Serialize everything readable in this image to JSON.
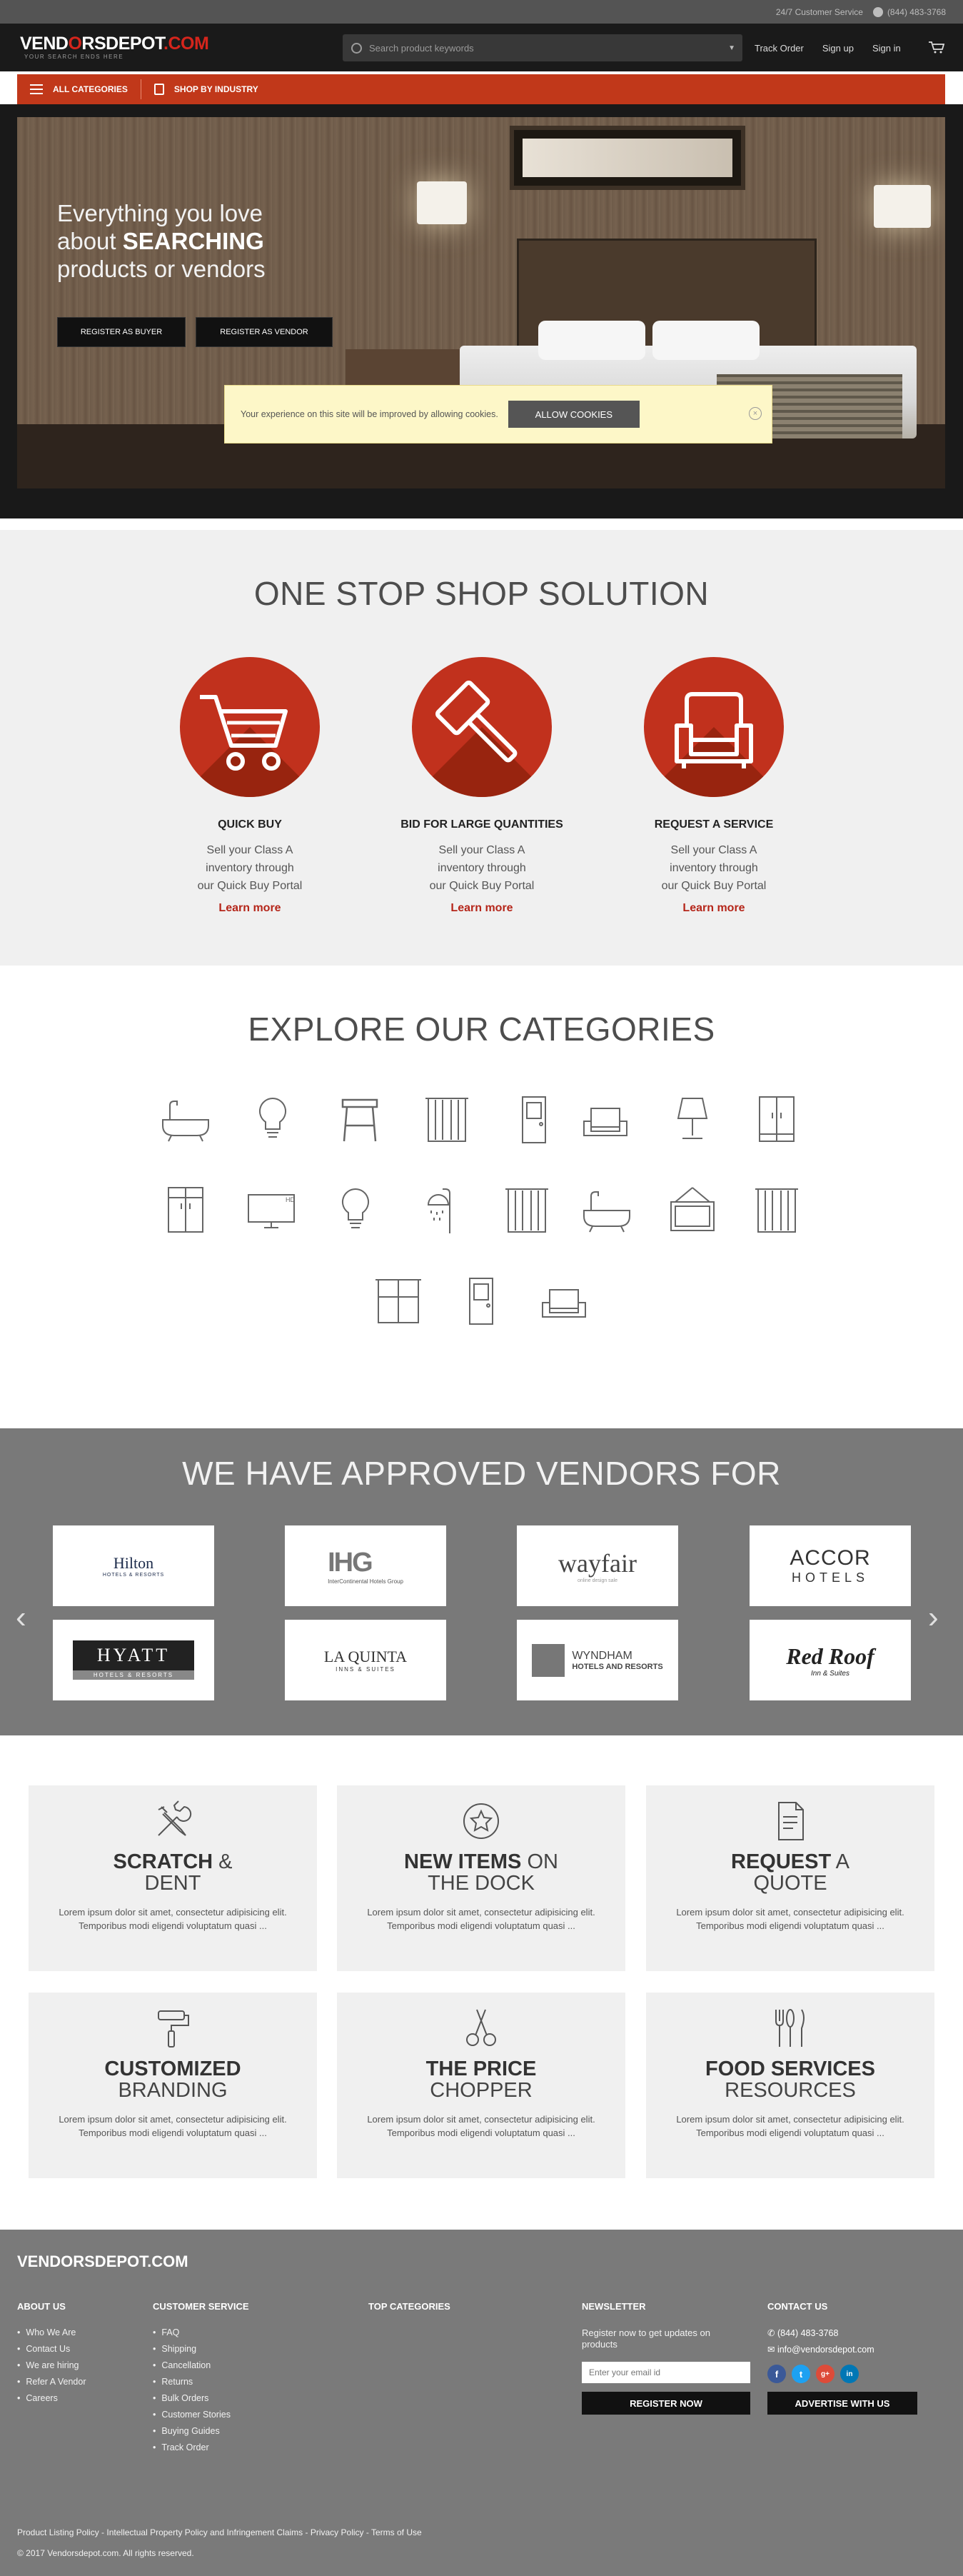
{
  "topbar": {
    "service": "24/7 Customer Service",
    "phone": "(844) 483-3768"
  },
  "header": {
    "logo_a": "VEND",
    "logo_o": "O",
    "logo_b": "RSDEPOT",
    "logo_c": ".COM",
    "tagline": "YOUR SEARCH ENDS HERE",
    "search_placeholder": "Search product keywords",
    "track_order": "Track Order",
    "sign_up": "Sign up",
    "sign_in": "Sign in"
  },
  "nav": {
    "all_categories": "ALL CATEGORIES",
    "shop_by_industry": "SHOP BY INDUSTRY"
  },
  "hero": {
    "line1": "Everything you love",
    "line2_a": "about",
    "line2_b": "SEARCHING",
    "line3": "products or vendors",
    "btn_buyer": "REGISTER AS BUYER",
    "btn_vendor": "REGISTER AS VENDOR"
  },
  "cookie": {
    "message": "Your experience on this site will be improved by allowing cookies.",
    "allow": "ALLOW COOKIES",
    "close": "×"
  },
  "onestop": {
    "title": "ONE STOP SHOP SOLUTION",
    "items": [
      {
        "title": "QUICK BUY",
        "l1": "Sell your Class A",
        "l2": "inventory through",
        "l3": "our Quick Buy Portal",
        "link": "Learn more",
        "icon": "cart-icon"
      },
      {
        "title": "BID FOR LARGE QUANTITIES",
        "l1": "Sell your Class A",
        "l2": "inventory through",
        "l3": "our Quick Buy Portal",
        "link": "Learn more",
        "icon": "gavel-icon"
      },
      {
        "title": "REQUEST A SERVICE",
        "l1": "Sell your Class A",
        "l2": "inventory through",
        "l3": "our Quick Buy Portal",
        "link": "Learn more",
        "icon": "armchair-icon"
      }
    ]
  },
  "explore": {
    "title": "EXPLORE OUR CATEGORIES",
    "icons": [
      "bathtub-icon",
      "lightbulb-icon",
      "stool-icon",
      "curtain-icon",
      "door-icon",
      "armchair-icon",
      "lamp-icon",
      "wardrobe-icon",
      "wardrobe-icon",
      "tv-icon",
      "lightbulb-icon",
      "shower-icon",
      "curtain-icon",
      "bathtub-icon",
      "picture-frame-icon",
      "curtain-icon",
      "window-icon",
      "door-icon",
      "armchair-icon"
    ],
    "tv_label": "HD"
  },
  "vendors": {
    "title": "WE HAVE APPROVED VENDORS FOR",
    "prev": "‹",
    "next": "›",
    "logos": [
      {
        "name": "Hilton",
        "sub": "HOTELS & RESORTS"
      },
      {
        "name": "IHG",
        "sub": "InterContinental Hotels Group"
      },
      {
        "name": "wayfair",
        "sub": "online design sale"
      },
      {
        "name": "ACCOR",
        "sub": "HOTELS"
      },
      {
        "name": "HYATT",
        "sub": "HOTELS & RESORTS"
      },
      {
        "name": "LA QUINTA",
        "sub": "INNS & SUITES"
      },
      {
        "name": "WYNDHAM",
        "sub": "HOTELS AND RESORTS"
      },
      {
        "name": "Red Roof",
        "sub": "Inn & Suites"
      }
    ]
  },
  "features": [
    {
      "bold1": "SCRATCH",
      "light1": "&",
      "light2": "DENT",
      "text1": "Lorem ipsum dolor sit amet, consectetur adipisicing elit.",
      "text2": "Temporibus modi eligendi voluptatum quasi ...",
      "icon": "tools-icon"
    },
    {
      "bold1": "NEW ITEMS",
      "light1": "ON",
      "light2": "THE DOCK",
      "text1": "Lorem ipsum dolor sit amet, consectetur adipisicing elit.",
      "text2": "Temporibus modi eligendi voluptatum quasi ...",
      "icon": "star-badge-icon"
    },
    {
      "bold1": "REQUEST",
      "light1": "A",
      "light2": "QUOTE",
      "text1": "Lorem ipsum dolor sit amet, consectetur adipisicing elit.",
      "text2": "Temporibus modi eligendi voluptatum quasi ...",
      "icon": "document-icon"
    },
    {
      "bold1": "CUSTOMIZED",
      "light1": "",
      "light2": "BRANDING",
      "text1": "Lorem ipsum dolor sit amet, consectetur adipisicing elit.",
      "text2": "Temporibus modi eligendi voluptatum quasi ...",
      "icon": "paint-roller-icon"
    },
    {
      "bold1": "THE PRICE",
      "light1": "",
      "light2": "CHOPPER",
      "text1": "Lorem ipsum dolor sit amet, consectetur adipisicing elit.",
      "text2": "Temporibus modi eligendi voluptatum quasi ...",
      "icon": "scissors-icon"
    },
    {
      "bold1": "FOOD SERVICES",
      "light1": "",
      "light2": "RESOURCES",
      "text1": "Lorem ipsum dolor sit amet, consectetur adipisicing elit.",
      "text2": "Temporibus modi eligendi voluptatum quasi ...",
      "icon": "cutlery-icon"
    }
  ],
  "footer": {
    "logo_a": "VEND",
    "logo_o": "O",
    "logo_b": "RSDEPOT.COM",
    "about": {
      "title": "ABOUT US",
      "items": [
        "Who We Are",
        "Contact Us",
        "We are hiring",
        "Refer A Vendor",
        "Careers"
      ]
    },
    "service": {
      "title": "CUSTOMER SERVICE",
      "items": [
        "FAQ",
        "Shipping",
        "Cancellation",
        "Returns",
        "Bulk Orders",
        "Customer Stories",
        "Buying Guides",
        "Track Order"
      ]
    },
    "top_categories": {
      "title": "TOP CATEGORIES"
    },
    "newsletter": {
      "title": "NEWSLETTER",
      "text": "Register now to get updates on products",
      "placeholder": "Enter your email id",
      "button": "REGISTER NOW"
    },
    "contact": {
      "title": "CONTACT US",
      "phone": "(844) 483-3768",
      "email": "info@vendorsdepot.com",
      "advertise": "ADVERTISE WITH US"
    },
    "social": {
      "facebook": "f",
      "twitter": "t",
      "google": "g+",
      "linkedin": "in"
    },
    "legal": "Product Listing Policy - Intellectual Property Policy and Infringement Claims - Privacy Policy - Terms of Use",
    "copyright": "© 2017 Vendorsdepot.com. All rights reserved."
  },
  "colors": {
    "brand_red": "#c1381a",
    "dark": "#1a1a1a",
    "vendors_bg": "#797979",
    "footer_bg": "#7a7a7a"
  }
}
